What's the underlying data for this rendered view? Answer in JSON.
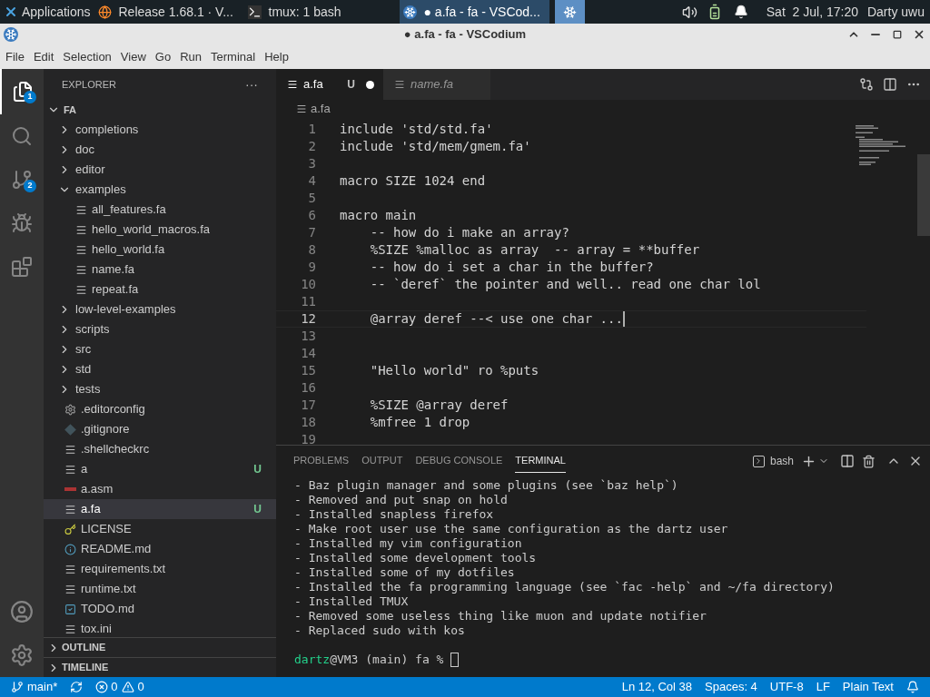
{
  "taskbar": {
    "menu": "Applications",
    "windows": [
      {
        "kind": "browser",
        "title": "Release 1.68.1 · V...",
        "selected": false
      },
      {
        "kind": "terminal",
        "title": "tmux: 1 bash",
        "selected": false
      },
      {
        "kind": "editor",
        "title": "● a.fa - fa - VSCod...",
        "selected": true
      }
    ],
    "clock": "Sat  2 Jul, 17:20",
    "user": "Darty uwu"
  },
  "window": {
    "title": "● a.fa - fa - VSCodium"
  },
  "menu": [
    "File",
    "Edit",
    "Selection",
    "View",
    "Go",
    "Run",
    "Terminal",
    "Help"
  ],
  "activity_bar": {
    "explorer_badge": "1",
    "scm_badge": "2"
  },
  "explorer": {
    "title": "EXPLORER",
    "more": "···",
    "root": {
      "label": "FA",
      "expanded": true,
      "children": [
        {
          "kind": "folder",
          "label": "completions",
          "expanded": false,
          "selected": false
        },
        {
          "kind": "folder",
          "label": "doc",
          "expanded": false,
          "selected": false
        },
        {
          "kind": "folder",
          "label": "editor",
          "expanded": false,
          "selected": false
        },
        {
          "kind": "folder",
          "label": "examples",
          "expanded": true,
          "selected": false,
          "children": [
            {
              "kind": "text",
              "label": "all_features.fa",
              "selected": false
            },
            {
              "kind": "text",
              "label": "hello_world_macros.fa",
              "selected": false
            },
            {
              "kind": "text",
              "label": "hello_world.fa",
              "selected": false
            },
            {
              "kind": "text",
              "label": "name.fa",
              "selected": false
            },
            {
              "kind": "text",
              "label": "repeat.fa",
              "selected": false
            }
          ]
        },
        {
          "kind": "folder",
          "label": "low-level-examples",
          "expanded": false,
          "selected": false
        },
        {
          "kind": "folder",
          "label": "scripts",
          "expanded": false,
          "selected": false
        },
        {
          "kind": "folder",
          "label": "src",
          "expanded": false,
          "selected": false
        },
        {
          "kind": "folder",
          "label": "std",
          "expanded": false,
          "selected": false
        },
        {
          "kind": "folder",
          "label": "tests",
          "expanded": false,
          "selected": false
        },
        {
          "kind": "config",
          "label": ".editorconfig",
          "selected": false
        },
        {
          "kind": "git",
          "label": ".gitignore",
          "selected": false
        },
        {
          "kind": "text",
          "label": ".shellcheckrc",
          "selected": false
        },
        {
          "kind": "text",
          "label": "a",
          "status": "U",
          "selected": false
        },
        {
          "kind": "asm",
          "label": "a.asm",
          "selected": false
        },
        {
          "kind": "text",
          "label": "a.fa",
          "status": "U",
          "selected": true
        },
        {
          "kind": "license",
          "label": "LICENSE",
          "selected": false
        },
        {
          "kind": "info",
          "label": "README.md",
          "selected": false
        },
        {
          "kind": "text",
          "label": "requirements.txt",
          "selected": false
        },
        {
          "kind": "text",
          "label": "runtime.txt",
          "selected": false
        },
        {
          "kind": "todo",
          "label": "TODO.md",
          "selected": false
        },
        {
          "kind": "text",
          "label": "tox.ini",
          "selected": false
        }
      ]
    },
    "sections": [
      {
        "label": "OUTLINE",
        "expanded": false
      },
      {
        "label": "TIMELINE",
        "expanded": false
      }
    ]
  },
  "editor": {
    "tabs": [
      {
        "label": "a.fa",
        "status": "U",
        "dirty": true,
        "preview": false,
        "selected": true
      },
      {
        "label": "name.fa",
        "dirty": false,
        "preview": true,
        "selected": false
      }
    ],
    "breadcrumb": "a.fa",
    "lines": [
      {
        "number": "1",
        "text": "include 'std/std.fa'",
        "current": false
      },
      {
        "number": "2",
        "text": "include 'std/mem/gmem.fa'",
        "current": false
      },
      {
        "number": "3",
        "current": false
      },
      {
        "number": "4",
        "text": "macro SIZE 1024 end",
        "current": false
      },
      {
        "number": "5",
        "current": false
      },
      {
        "number": "6",
        "text": "macro main",
        "current": false
      },
      {
        "number": "7",
        "text": "    -- how do i make an array?",
        "current": false
      },
      {
        "number": "8",
        "text": "    %SIZE %malloc as array  -- array = **buffer",
        "current": false
      },
      {
        "number": "9",
        "text": "    -- how do i set a char in the buffer?",
        "current": false
      },
      {
        "number": "10",
        "text": "    -- `deref` the pointer and well.. read one char lol",
        "current": false
      },
      {
        "number": "11",
        "current": false
      },
      {
        "number": "12",
        "text": "    @array deref --< use one char ...",
        "current": true
      },
      {
        "number": "13",
        "current": false
      },
      {
        "number": "14",
        "current": false
      },
      {
        "number": "15",
        "text": "    \"Hello world\" ro %puts",
        "current": false
      },
      {
        "number": "16",
        "current": false
      },
      {
        "number": "17",
        "text": "    %SIZE @array deref",
        "current": false
      },
      {
        "number": "18",
        "text": "    %mfree 1 drop",
        "current": false
      },
      {
        "number": "19",
        "current": false
      }
    ]
  },
  "panel": {
    "tabs": [
      {
        "label": "PROBLEMS",
        "selected": false
      },
      {
        "label": "OUTPUT",
        "selected": false
      },
      {
        "label": "DEBUG CONSOLE",
        "selected": false
      },
      {
        "label": "TERMINAL",
        "selected": true
      }
    ],
    "shell": "bash",
    "terminal_lines": [
      "- Baz plugin manager and some plugins (see `baz help`)",
      "- Removed and put snap on hold",
      "- Installed snapless firefox",
      "- Make root user use the same configuration as the dartz user",
      "- Installed my vim configuration",
      "- Installed some development tools",
      "- Installed some of my dotfiles",
      "- Installed the fa programming language (see `fac -help` and ~/fa directory)",
      "- Installed TMUX",
      "- Removed some useless thing like muon and update notifier",
      "- Replaced sudo with kos"
    ],
    "prompt_user": "dartz",
    "prompt_rest": "@VM3 (main) fa % "
  },
  "status_bar": {
    "branch": "main*",
    "errors": "0",
    "warnings": "0",
    "position": "Ln 12, Col 38",
    "indent": "Spaces: 4",
    "encoding": "UTF-8",
    "eol": "LF",
    "language": "Plain Text"
  }
}
